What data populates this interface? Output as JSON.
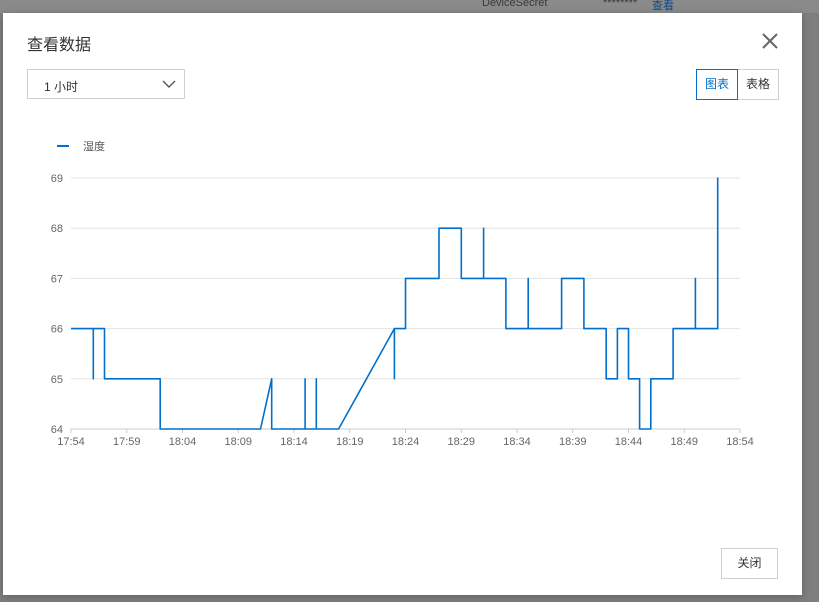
{
  "background": {
    "field_label": "DeviceSecret",
    "masked_value": "********",
    "view_link": "查看"
  },
  "modal": {
    "title": "查看数据",
    "time_range": {
      "selected": "1 小时"
    },
    "view_toggle": {
      "chart_label": "图表",
      "table_label": "表格",
      "active": "chart"
    },
    "close_button": "关闭"
  },
  "chart_data": {
    "type": "line",
    "series": [
      {
        "name": "湿度",
        "color": "#0070cc",
        "points": [
          [
            "17:54",
            66
          ],
          [
            "17:56",
            66
          ],
          [
            "17:56",
            65
          ],
          [
            "17:56",
            66
          ],
          [
            "17:57",
            66
          ],
          [
            "17:57",
            65
          ],
          [
            "17:57",
            66
          ],
          [
            "17:57",
            65
          ],
          [
            "18:02",
            65
          ],
          [
            "18:02",
            64
          ],
          [
            "18:11",
            64
          ],
          [
            "18:12",
            65
          ],
          [
            "18:12",
            64
          ],
          [
            "18:15",
            64
          ],
          [
            "18:15",
            65
          ],
          [
            "18:15",
            64
          ],
          [
            "18:16",
            64
          ],
          [
            "18:16",
            65
          ],
          [
            "18:16",
            64
          ],
          [
            "18:18",
            64
          ],
          [
            "18:23",
            66
          ],
          [
            "18:23",
            65
          ],
          [
            "18:23",
            66
          ],
          [
            "18:24",
            66
          ],
          [
            "18:24",
            67
          ],
          [
            "18:24",
            66
          ],
          [
            "18:24",
            67
          ],
          [
            "18:27",
            67
          ],
          [
            "18:27",
            68
          ],
          [
            "18:29",
            68
          ],
          [
            "18:29",
            67
          ],
          [
            "18:31",
            67
          ],
          [
            "18:31",
            68
          ],
          [
            "18:31",
            67
          ],
          [
            "18:31",
            68
          ],
          [
            "18:31",
            67
          ],
          [
            "18:33",
            67
          ],
          [
            "18:33",
            66
          ],
          [
            "18:35",
            66
          ],
          [
            "18:35",
            67
          ],
          [
            "18:35",
            66
          ],
          [
            "18:38",
            66
          ],
          [
            "18:38",
            67
          ],
          [
            "18:40",
            67
          ],
          [
            "18:40",
            66
          ],
          [
            "18:42",
            66
          ],
          [
            "18:42",
            65
          ],
          [
            "18:43",
            65
          ],
          [
            "18:43",
            66
          ],
          [
            "18:44",
            66
          ],
          [
            "18:44",
            65
          ],
          [
            "18:45",
            65
          ],
          [
            "18:45",
            64
          ],
          [
            "18:46",
            64
          ],
          [
            "18:46",
            65
          ],
          [
            "18:48",
            65
          ],
          [
            "18:48",
            66
          ],
          [
            "18:50",
            66
          ],
          [
            "18:50",
            67
          ],
          [
            "18:50",
            66
          ],
          [
            "18:52",
            66
          ],
          [
            "18:52",
            68
          ],
          [
            "18:52",
            69
          ],
          [
            "18:52",
            68
          ],
          [
            "18:52",
            69
          ]
        ]
      }
    ],
    "x_ticks": [
      "17:54",
      "17:59",
      "18:04",
      "18:09",
      "18:14",
      "18:19",
      "18:24",
      "18:29",
      "18:34",
      "18:39",
      "18:44",
      "18:49",
      "18:54"
    ],
    "y_ticks": [
      64,
      65,
      66,
      67,
      68,
      69
    ],
    "xlim": [
      "17:54",
      "18:54"
    ],
    "ylim": [
      64,
      69
    ],
    "grid": "horizontal",
    "legend": "top-left"
  }
}
